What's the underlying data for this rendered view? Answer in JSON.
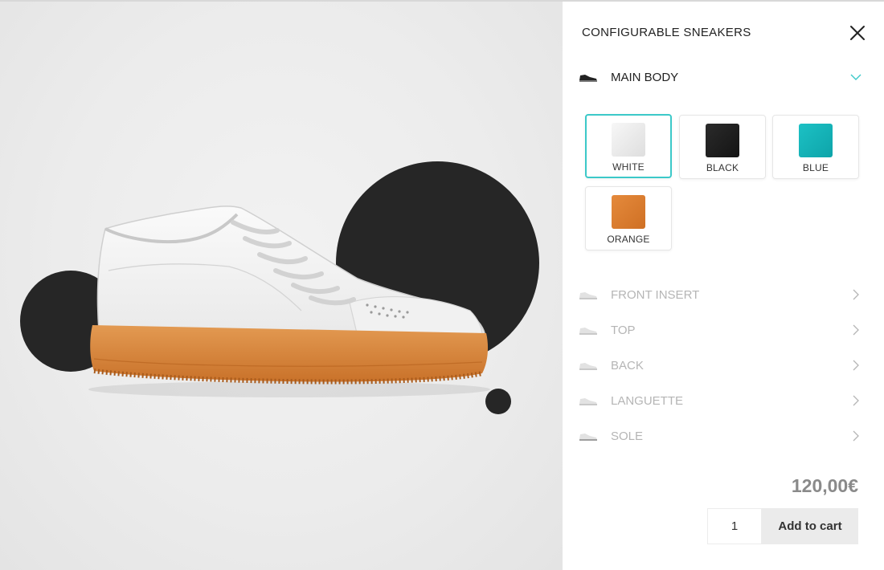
{
  "product": {
    "title": "CONFIGURABLE SNEAKERS",
    "close_icon": "close-icon"
  },
  "stage": {
    "shoe_colors": {
      "upper": "#f4f4f4",
      "sole": "#d9843a",
      "accent": "#262626"
    }
  },
  "sections": [
    {
      "label": "MAIN BODY",
      "expanded": true,
      "icon": "sneaker-icon"
    },
    {
      "label": "FRONT INSERT",
      "expanded": false,
      "icon": "sneaker-icon"
    },
    {
      "label": "TOP",
      "expanded": false,
      "icon": "sneaker-icon"
    },
    {
      "label": "BACK",
      "expanded": false,
      "icon": "sneaker-icon"
    },
    {
      "label": "LANGUETTE",
      "expanded": false,
      "icon": "sneaker-icon"
    },
    {
      "label": "SOLE",
      "expanded": false,
      "icon": "sneaker-icon"
    }
  ],
  "swatches": [
    {
      "label": "WHITE",
      "color": "#ececec",
      "selected": true
    },
    {
      "label": "BLACK",
      "color": "#1f1f1f",
      "selected": false
    },
    {
      "label": "BLUE",
      "color": "#12b3b8",
      "selected": false
    },
    {
      "label": "ORANGE",
      "color": "#dd7e32",
      "selected": false
    }
  ],
  "cart": {
    "price": "120,00€",
    "quantity": "1",
    "add_label": "Add to cart"
  },
  "colors": {
    "accent": "#3cc9c9",
    "inactive_text": "#b5b5b5"
  }
}
